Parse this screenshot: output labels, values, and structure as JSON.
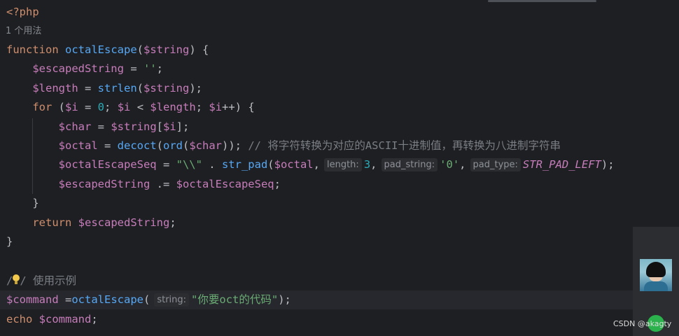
{
  "editor": {
    "line1": {
      "open_tag": "<?php"
    },
    "usage_hint": "1 个用法",
    "line3": {
      "kw": "function",
      "fn": "octalEscape",
      "p1": "(",
      "var": "$string",
      "p2": ") {"
    },
    "line4": {
      "indent": "    ",
      "var": "$escapedString",
      "op": " = ",
      "str": "''",
      "end": ";"
    },
    "line5": {
      "indent": "    ",
      "var1": "$length",
      "op": " = ",
      "fn": "strlen",
      "p1": "(",
      "var2": "$string",
      "p2": ");"
    },
    "line6": {
      "indent": "    ",
      "kw": "for",
      "t1": " (",
      "v1": "$i",
      "t2": " = ",
      "n0": "0",
      "t3": "; ",
      "v2": "$i",
      "t4": " < ",
      "v3": "$length",
      "t5": "; ",
      "v4": "$i",
      "t6": "++) {"
    },
    "line7": {
      "indent": "        ",
      "v1": "$char",
      "t1": " = ",
      "v2": "$string",
      "t2": "[",
      "v3": "$i",
      "t3": "];"
    },
    "line8": {
      "indent": "        ",
      "v1": "$octal",
      "t1": " = ",
      "fn1": "decoct",
      "t2": "(",
      "fn2": "ord",
      "t3": "(",
      "v2": "$char",
      "t4": ")); ",
      "comment": "// 将字符转换为对应的ASCII十进制值，再转换为八进制字符串"
    },
    "line9": {
      "indent": "        ",
      "v1": "$octalEscapeSeq",
      "t1": " = ",
      "s1": "\"\\\\\"",
      "t2": " . ",
      "fn": "str_pad",
      "t3": "(",
      "v2": "$octal",
      "t4": ",",
      "hint1": "length:",
      "n3": "3",
      "t5": ",",
      "hint2": "pad_string:",
      "s2": "'0'",
      "t6": ",",
      "hint3": "pad_type:",
      "const": "STR_PAD_LEFT",
      "t7": ");"
    },
    "line10": {
      "indent": "        ",
      "v1": "$escapedString",
      "t1": " .= ",
      "v2": "$octalEscapeSeq",
      "t2": ";"
    },
    "line11": {
      "text": "    }"
    },
    "line12": {
      "indent": "    ",
      "kw": "return",
      "t1": " ",
      "v1": "$escapedString",
      "t2": ";"
    },
    "line13": {
      "text": "}"
    },
    "line15": {
      "slash": "/",
      "slash2": "/",
      "comment": " 使用示例"
    },
    "line16": {
      "v1": "$command",
      "t1": " =",
      "fn": "octalEscape",
      "t2": "(",
      "hint": "string:",
      "s1": "\"你要oct的代码\"",
      "t3": ");"
    },
    "line17": {
      "fn": "echo",
      "t1": " ",
      "v1": "$command",
      "t2": ";"
    }
  },
  "watermark": "CSDN @akagty",
  "colors": {
    "background": "#1e1f22",
    "keyword": "#cf8e6d",
    "function": "#56a8f5",
    "variable": "#c77dbb",
    "string": "#6aab73",
    "number": "#2aacb8",
    "comment": "#7a7e85",
    "text": "#bcbec4"
  },
  "icons": [
    "lightbulb-icon",
    "avatar",
    "green-status-dot"
  ]
}
